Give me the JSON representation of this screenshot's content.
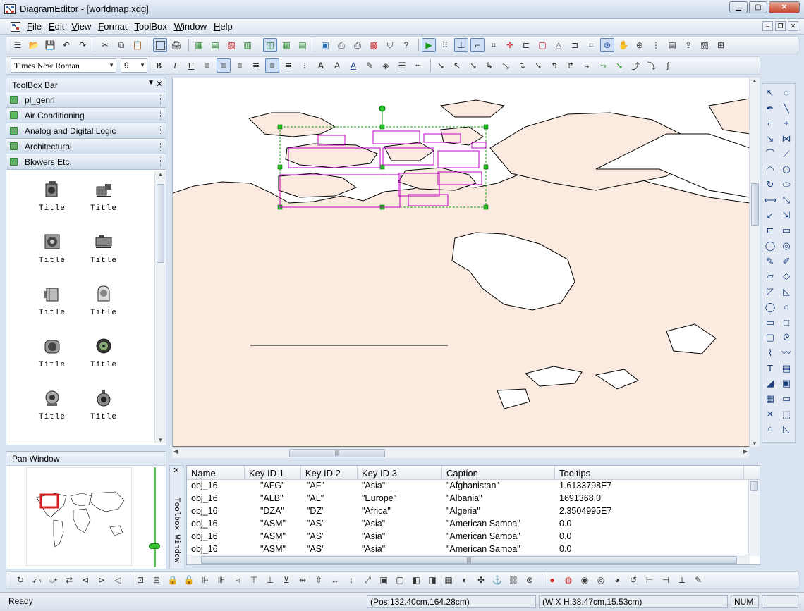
{
  "window": {
    "app_name": "DiagramEditor",
    "title": "DiagramEditor - [worldmap.xdg]",
    "minimize": "▁",
    "maximize": "▢",
    "close": "✕"
  },
  "menu": {
    "items": [
      "File",
      "Edit",
      "View",
      "Format",
      "ToolBox",
      "Window",
      "Help"
    ],
    "mdi_minimize": "–",
    "mdi_restore": "❐",
    "mdi_close": "✕"
  },
  "format_toolbar": {
    "font_name": "Times New Roman",
    "font_size": "9"
  },
  "toolbox": {
    "title": "ToolBox Bar",
    "categories": [
      "pl_genrl",
      "Air Conditioning",
      "Analog and Digital Logic",
      "Architectural",
      "Blowers Etc."
    ],
    "shapes": [
      {
        "label": "Title",
        "icon": "blower-unit-icon"
      },
      {
        "label": "Title",
        "icon": "motor-blower-icon"
      },
      {
        "label": "Title",
        "icon": "centrifugal-fan-icon"
      },
      {
        "label": "Title",
        "icon": "inline-blower-icon"
      },
      {
        "label": "Title",
        "icon": "axial-fan-icon"
      },
      {
        "label": "Title",
        "icon": "scroll-fan-icon"
      },
      {
        "label": "Title",
        "icon": "housed-fan-icon"
      },
      {
        "label": "Title",
        "icon": "impeller-fan-icon"
      },
      {
        "label": "Title",
        "icon": "volute-blower-icon"
      },
      {
        "label": "Title",
        "icon": "radial-blower-icon"
      }
    ]
  },
  "pan_window": {
    "title": "Pan Window"
  },
  "toolbox_window_tab": "Toolbox Window",
  "table": {
    "columns": [
      "Name",
      "Key ID 1",
      "Key ID 2",
      "Key ID 3",
      "Caption",
      "Tooltips"
    ],
    "rows": [
      [
        "obj_16",
        "\"AFG\"",
        "\"AF\"",
        "\"Asia\"",
        "\"Afghanistan\"",
        "1.6133798E7"
      ],
      [
        "obj_16",
        "\"ALB\"",
        "\"AL\"",
        "\"Europe\"",
        "\"Albania\"",
        "1691368.0"
      ],
      [
        "obj_16",
        "\"DZA\"",
        "\"DZ\"",
        "\"Africa\"",
        "\"Algeria\"",
        "2.3504995E7"
      ],
      [
        "obj_16",
        "\"ASM\"",
        "\"AS\"",
        "\"Asia\"",
        "\"American Samoa\"",
        "0.0"
      ],
      [
        "obj_16",
        "\"ASM\"",
        "\"AS\"",
        "\"Asia\"",
        "\"American Samoa\"",
        "0.0"
      ],
      [
        "obj_16",
        "\"ASM\"",
        "\"AS\"",
        "\"Asia\"",
        "\"American Samoa\"",
        "0.0"
      ]
    ]
  },
  "status": {
    "ready": "Ready",
    "position": "(Pos:132.40cm,164.28cm)",
    "size": "(W X H:38.47cm,15.53cm)",
    "num": "NUM"
  },
  "colors": {
    "land": "#faeae0",
    "selection": "#c000c0",
    "handles": "#22c022",
    "accent": "#3b6fb6"
  }
}
